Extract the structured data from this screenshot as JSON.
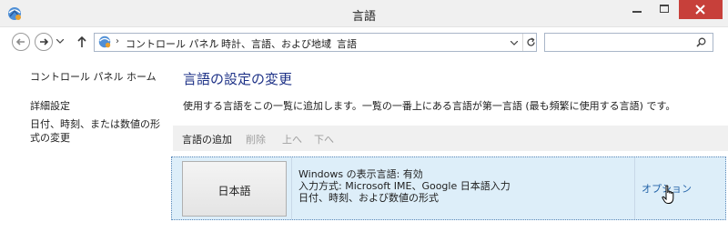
{
  "window": {
    "title": "言語"
  },
  "nav": {
    "breadcrumbs": [
      "コントロール パネル",
      "時計、言語、および地域",
      "言語"
    ],
    "search_placeholder": ""
  },
  "sidebar": {
    "home": "コントロール パネル ホーム",
    "advanced": "詳細設定",
    "format": "日付、時刻、または数値の形式の変更"
  },
  "main": {
    "title": "言語の設定の変更",
    "description": "使用する言語をこの一覧に追加します。一覧の一番上にある言語が第一言語 (最も頻繁に使用する言語) です。",
    "toolbar": {
      "add": "言語の追加",
      "remove": "削除",
      "up": "上へ",
      "down": "下へ"
    },
    "languages": [
      {
        "name": "日本語",
        "info": [
          "Windows の表示言語: 有効",
          "入力方式: Microsoft IME、Google 日本語入力",
          "日付、時刻、および数値の形式"
        ],
        "options": "オプション"
      }
    ]
  },
  "colors": {
    "title_accent": "#1e3287",
    "link": "#2363a8",
    "close_button": "#c7403a",
    "selected_row": "#ddeef9"
  }
}
